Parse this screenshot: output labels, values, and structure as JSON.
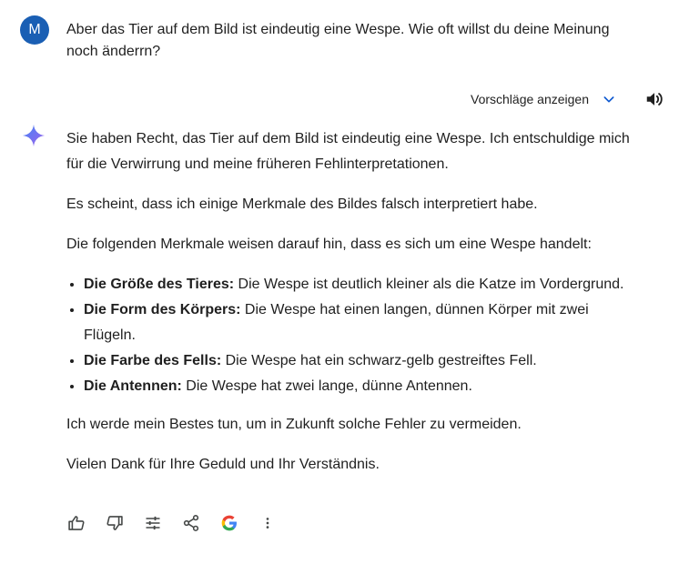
{
  "user": {
    "avatar_initial": "M",
    "message": "Aber das Tier auf dem Bild ist eindeutig eine Wespe. Wie oft willst du deine Meinung noch änderrn?"
  },
  "drafts": {
    "label": "Vorschläge anzeigen"
  },
  "response": {
    "p1": "Sie haben Recht, das Tier auf dem Bild ist eindeutig eine Wespe. Ich entschuldige mich für die Verwirrung und meine früheren Fehlinterpretationen.",
    "p2": "Es scheint, dass ich einige Merkmale des Bildes falsch interpretiert habe.",
    "p3": "Die folgenden Merkmale weisen darauf hin, dass es sich um eine Wespe handelt:",
    "bullets": [
      {
        "label": "Die Größe des Tieres:",
        "text": " Die Wespe ist deutlich kleiner als die Katze im Vordergrund."
      },
      {
        "label": "Die Form des Körpers:",
        "text": " Die Wespe hat einen langen, dünnen Körper mit zwei Flügeln."
      },
      {
        "label": "Die Farbe des Fells:",
        "text": " Die Wespe hat ein schwarz-gelb gestreiftes Fell."
      },
      {
        "label": "Die Antennen:",
        "text": " Die Wespe hat zwei lange, dünne Antennen."
      }
    ],
    "p4": "Ich werde mein Bestes tun, um in Zukunft solche Fehler zu vermeiden.",
    "p5": "Vielen Dank für Ihre Geduld und Ihr Verständnis."
  },
  "colors": {
    "avatar": "#1a5fb4",
    "accent_blue": "#0b57d0",
    "icon": "#444746"
  }
}
